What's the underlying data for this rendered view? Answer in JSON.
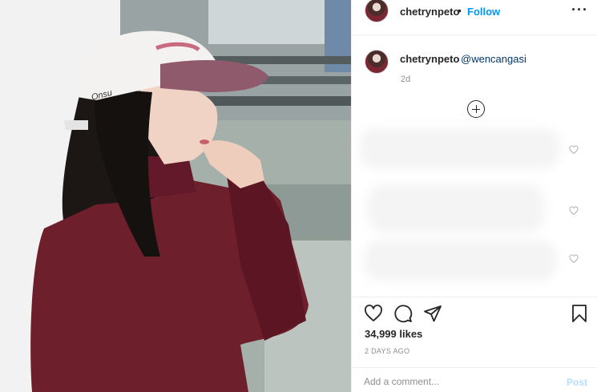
{
  "post": {
    "author": "chetrynpeto",
    "separator": "•",
    "follow_label": "Follow",
    "more_label": "···"
  },
  "caption": {
    "author": "chetrynpeto",
    "mention": "@wencangasi",
    "time": "2d"
  },
  "photo": {
    "cap_text": "Onsu"
  },
  "actions": {
    "likes": "34,999 likes",
    "date": "2 DAYS AGO"
  },
  "comment_box": {
    "placeholder": "Add a comment...",
    "post_label": "Post"
  },
  "colors": {
    "accent_blue": "#0095f6",
    "mention_blue": "#00376b",
    "post_disabled": "#b2dffc",
    "sweater": "#6e1f2c"
  },
  "icons": [
    "more-options-icon",
    "load-more-comments-icon",
    "comment-like-icon",
    "heart-icon",
    "comment-icon",
    "share-icon",
    "bookmark-icon"
  ]
}
